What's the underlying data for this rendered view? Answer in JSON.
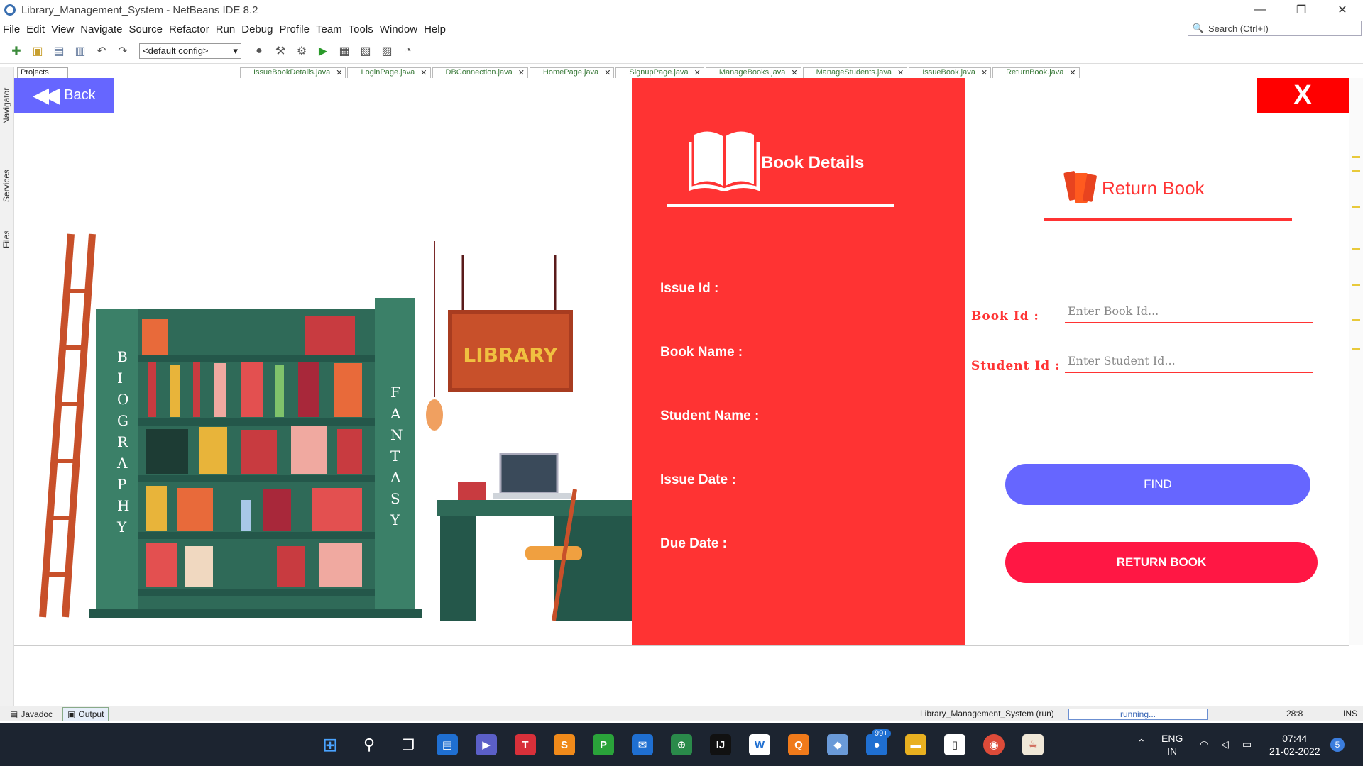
{
  "window": {
    "title": "Library_Management_System - NetBeans IDE 8.2"
  },
  "menu": [
    "File",
    "Edit",
    "View",
    "Navigate",
    "Source",
    "Refactor",
    "Run",
    "Debug",
    "Profile",
    "Team",
    "Tools",
    "Window",
    "Help"
  ],
  "ide_search": {
    "placeholder": "Search (Ctrl+I)"
  },
  "toolbar": {
    "config": "<default config>"
  },
  "tabs": {
    "projects": "Projects",
    "editor": [
      "IssueBookDetails.java",
      "LoginPage.java",
      "DBConnection.java",
      "HomePage.java",
      "SignupPage.java",
      "ManageBooks.java",
      "ManageStudents.java",
      "IssueBook.java",
      "ReturnBook.java"
    ]
  },
  "side_panels": [
    "Navigator",
    "Services",
    "Files"
  ],
  "app": {
    "back_label": "Back",
    "close_label": "X",
    "illustration": {
      "library_sign": "LIBRARY",
      "left_spine": "BIOGRAPHY",
      "right_spine": "FANTASY"
    },
    "details": {
      "title": "Book Details",
      "labels": [
        "Issue Id :",
        "Book Name :",
        "Student Name :",
        "Issue Date :",
        "Due Date :"
      ]
    },
    "form": {
      "title": "Return Book",
      "book_id_label": "Book Id :",
      "book_id_placeholder": "Enter Book Id...",
      "student_id_label": "Student Id :",
      "student_id_placeholder": "Enter Student Id...",
      "find_label": "FIND",
      "return_label": "RETURN BOOK"
    },
    "colors": {
      "accent_red": "#ff3333",
      "accent_blue": "#6666ff",
      "return_red": "#ff1744"
    }
  },
  "status": {
    "javadoc": "Javadoc",
    "output": "Output",
    "run_target": "Library_Management_System (run)",
    "progress": "running...",
    "position": "28:8",
    "mode": "INS"
  },
  "taskbar": {
    "lang": "ENG",
    "region": "IN",
    "time": "07:44",
    "date": "21-02-2022",
    "badge": "99+",
    "notifications": "5"
  }
}
